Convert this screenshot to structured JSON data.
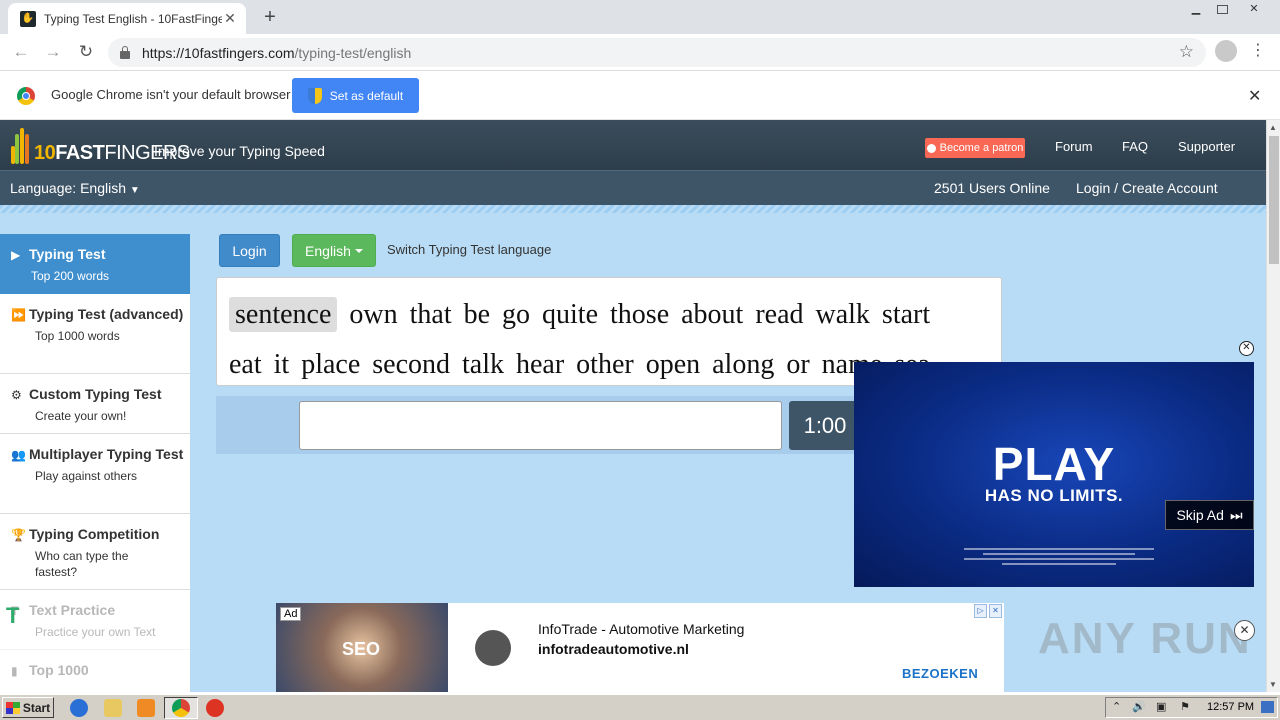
{
  "browser": {
    "tab_title": "Typing Test English - 10FastFingers.com",
    "new_tab": "+",
    "url_domain": "https://10fastfingers.com",
    "url_path": "/typing-test/english"
  },
  "infobar": {
    "message": "Google Chrome isn't your default browser",
    "button": "Set as default"
  },
  "site": {
    "logo_ten": "10",
    "logo_fast": "FAST",
    "logo_fingers": "FINGERS",
    "tagline": "Improve your Typing Speed",
    "patron": "Become a patron",
    "nav": [
      "Forum",
      "FAQ",
      "Supporter"
    ],
    "language": "Language: English",
    "users_online": "2501 Users Online",
    "login_create": "Login / Create Account"
  },
  "sidebar": {
    "items": [
      {
        "title": "Typing Test",
        "sub": "Top 200 words",
        "icon": "play-icon"
      },
      {
        "title": "Typing Test (advanced)",
        "sub": "Top 1000 words",
        "icon": "fast-forward-icon"
      },
      {
        "title": "Custom Typing Test",
        "sub": "Create your own!",
        "icon": "cogs-icon"
      },
      {
        "title": "Multiplayer Typing Test",
        "sub": "Play against others",
        "icon": "users-icon"
      },
      {
        "title": "Typing Competition",
        "sub": "Who can type the fastest?",
        "icon": "trophy-icon"
      },
      {
        "title": "Text Practice",
        "sub": "Practice your own Text",
        "icon": "text-icon"
      },
      {
        "title": "Top 1000",
        "sub": "",
        "icon": "bars-icon"
      }
    ]
  },
  "test": {
    "login_button": "Login",
    "language_button": "English",
    "switch_text": "Switch Typing Test language",
    "current_word": "sentence",
    "words_line1": "own that be go quite those about read walk start",
    "words_line2": "eat it place second talk hear other open along or name sea",
    "timer": "1:00"
  },
  "video_ad": {
    "title": "PLAY",
    "subtitle": "HAS NO LIMITS.",
    "skip": "Skip Ad"
  },
  "banner_ad": {
    "badge": "Ad",
    "image_text": "SEO",
    "title": "InfoTrade - Automotive Marketing",
    "domain": "infotradeautomotive.nl",
    "cta": "BEZOEKEN"
  },
  "watermark": "ANY RUN",
  "taskbar": {
    "start": "Start",
    "clock": "12:57 PM"
  }
}
